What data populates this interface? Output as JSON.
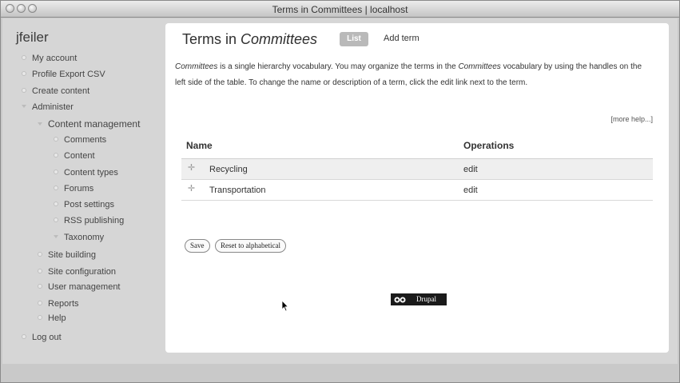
{
  "window": {
    "title": "Terms in Committees | localhost"
  },
  "sidebar": {
    "username": "jfeiler",
    "items": [
      {
        "label": "My account"
      },
      {
        "label": "Profile Export CSV"
      },
      {
        "label": "Create content"
      },
      {
        "label": "Administer"
      },
      {
        "label": "Content management"
      },
      {
        "label": "Comments"
      },
      {
        "label": "Content"
      },
      {
        "label": "Content types"
      },
      {
        "label": "Forums"
      },
      {
        "label": "Post settings"
      },
      {
        "label": "RSS publishing"
      },
      {
        "label": "Taxonomy"
      },
      {
        "label": "Site building"
      },
      {
        "label": "Site configuration"
      },
      {
        "label": "User management"
      },
      {
        "label": "Reports"
      },
      {
        "label": "Help"
      },
      {
        "label": "Log out"
      }
    ]
  },
  "main": {
    "title_prefix": "Terms in",
    "title_vocab": "Committees",
    "tabs": [
      {
        "label": "List",
        "active": true
      },
      {
        "label": "Add term",
        "active": false
      }
    ],
    "description": {
      "vocab": "Committees",
      "part1": " is a single hierarchy vocabulary. You may organize the terms in the ",
      "vocab2": "Committees",
      "part2": " vocabulary by using the handles on the left side of the table. To change the name or description of a term, click the edit link next to the term."
    },
    "more_help": "[more help...]",
    "table": {
      "headers": [
        "Name",
        "Operations"
      ],
      "rows": [
        {
          "name": "Recycling",
          "op": "edit"
        },
        {
          "name": "Transportation",
          "op": "edit"
        }
      ]
    },
    "buttons": {
      "save": "Save",
      "reset": "Reset to alphabetical"
    },
    "footer_badge": "Drupal"
  }
}
